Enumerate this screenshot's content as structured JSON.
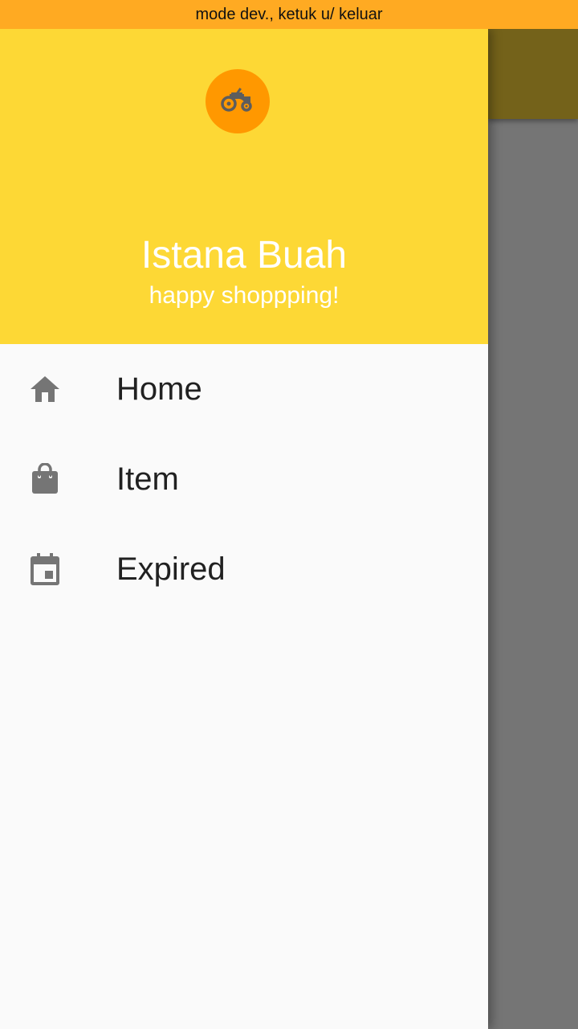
{
  "status_bar": {
    "text": "mode dev., ketuk u/ keluar"
  },
  "drawer": {
    "header": {
      "avatar_icon": "tractor-icon",
      "title": "Istana Buah",
      "subtitle": "happy shoppping!"
    },
    "items": [
      {
        "label": "Home",
        "icon": "home-icon"
      },
      {
        "label": "Item",
        "icon": "shopping-bag-icon"
      },
      {
        "label": "Expired",
        "icon": "calendar-event-icon"
      }
    ]
  },
  "colors": {
    "status_bar": "#FFAA22",
    "header": "#FDD835",
    "avatar": "#FF9800",
    "icon_gray": "#757575",
    "scrim": "#757575",
    "appbar_dimmed": "#74621A"
  }
}
